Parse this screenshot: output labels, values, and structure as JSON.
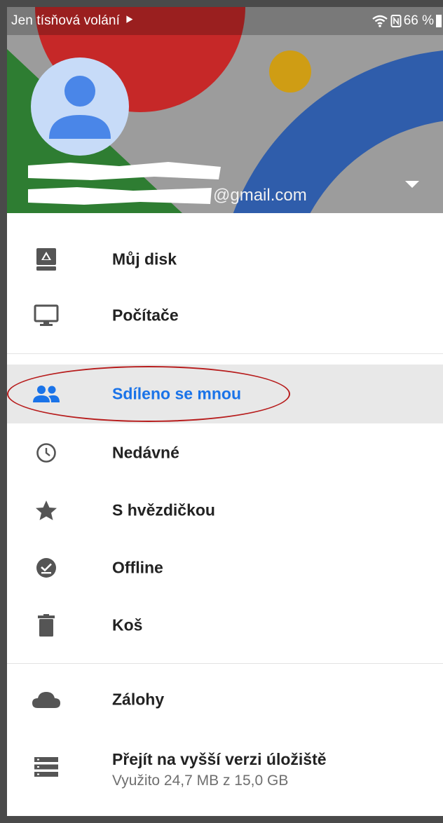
{
  "status_bar": {
    "carrier_text": "Jen tísňová volání ⯈",
    "battery_text": "66 %"
  },
  "account": {
    "email_suffix": "@gmail.com"
  },
  "menu": {
    "items": [
      {
        "label": "Můj disk",
        "icon": "drive-icon"
      },
      {
        "label": "Počítače",
        "icon": "computer-icon"
      },
      {
        "label": "Sdíleno se mnou",
        "icon": "people-icon",
        "selected": true
      },
      {
        "label": "Nedávné",
        "icon": "clock-icon"
      },
      {
        "label": "S hvězdičkou",
        "icon": "star-icon"
      },
      {
        "label": "Offline",
        "icon": "offline-check-icon"
      },
      {
        "label": "Koš",
        "icon": "trash-icon"
      },
      {
        "label": "Zálohy",
        "icon": "cloud-icon"
      },
      {
        "label": "Přejít na vyšší verzi úložiště",
        "icon": "storage-icon"
      }
    ],
    "storage_sub": "Využito 24,7 MB z 15,0 GB"
  },
  "colors": {
    "accent": "#1a73e8",
    "selected_bg": "#e8e8e8",
    "annotation": "#b71c1c",
    "header_red": "#c62828",
    "header_blue": "#2f5dab",
    "header_green": "#2e7d32",
    "header_yellow": "#d4a017"
  }
}
